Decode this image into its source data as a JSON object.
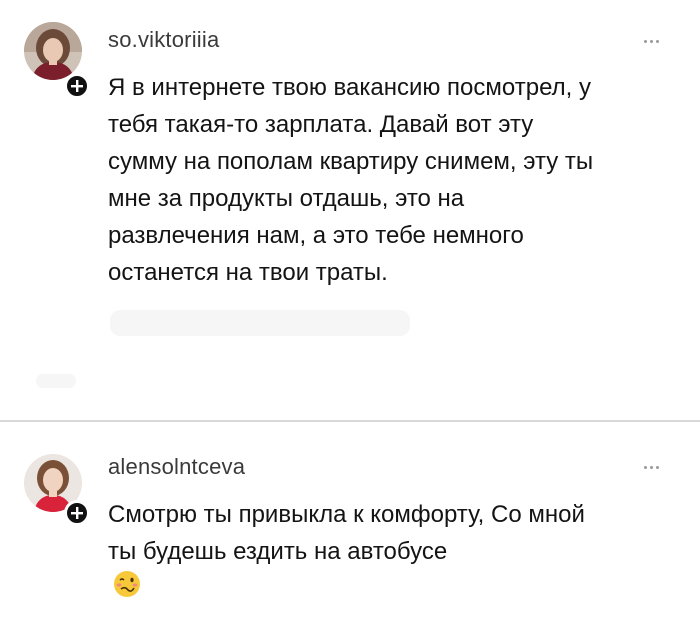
{
  "comments": [
    {
      "username": "so.viktoriiia",
      "text": "Я в интернете твою вакансию посмотрел, у\nтебя такая-то зарплата. Давай вот эту\nсумму на пополам квартиру снимем, эту ты\nмне за продукты отдашь, это на\nразвлечения нам, а это тебе немного\nостанется на твои траты.",
      "avatar_icon": "profile-photo-woman-dark-hair",
      "badge_icon": "plus-icon"
    },
    {
      "username": "alensolntceva",
      "text": "Смотрю ты привыкла к комфорту, Со мной\nты будешь ездить на автобусе",
      "emoji_icon": "woozy-face-emoji",
      "avatar_icon": "profile-photo-woman-brown-hair",
      "badge_icon": "plus-icon"
    }
  ],
  "colors": {
    "background": "#ffffff",
    "text": "#141414",
    "username": "#3a3a3a",
    "divider": "#d9d9d9",
    "menu_dots": "#9a9a9a",
    "badge": "#111111"
  }
}
